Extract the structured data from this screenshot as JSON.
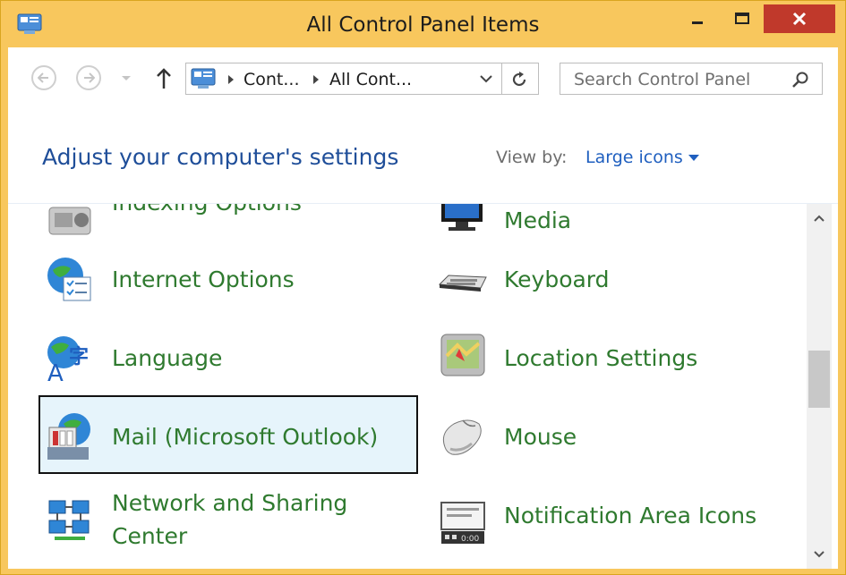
{
  "window": {
    "title": "All Control Panel Items"
  },
  "nav": {
    "breadcrumb": [
      "Cont...",
      "All Cont..."
    ],
    "search_placeholder": "Search Control Panel"
  },
  "header": {
    "heading": "Adjust your computer's settings",
    "view_by_label": "View by:",
    "view_by_value": "Large icons"
  },
  "items": {
    "indexing": "Indexing Options",
    "media": "Media",
    "internet_options": "Internet Options",
    "keyboard": "Keyboard",
    "language": "Language",
    "location": "Location Settings",
    "mail": "Mail (Microsoft Outlook)",
    "mouse": "Mouse",
    "network_line1": "Network and Sharing",
    "network_line2": "Center",
    "notification": "Notification Area Icons"
  },
  "colors": {
    "title_bar": "#f8c75d",
    "close_button": "#c0392b",
    "link_green": "#2f7a2f",
    "heading_blue": "#1f4e99",
    "selection_fill": "#e6f4fb"
  },
  "icons": [
    "control-panel-icon",
    "back-arrow-icon",
    "forward-arrow-icon",
    "up-arrow-icon",
    "refresh-icon",
    "search-icon",
    "minimize-icon",
    "maximize-icon",
    "close-icon",
    "dropdown-caret-icon",
    "indexing-icon",
    "media-icon",
    "internet-options-icon",
    "keyboard-icon",
    "language-icon",
    "location-icon",
    "mail-icon",
    "mouse-icon",
    "network-icon",
    "notification-icon"
  ]
}
